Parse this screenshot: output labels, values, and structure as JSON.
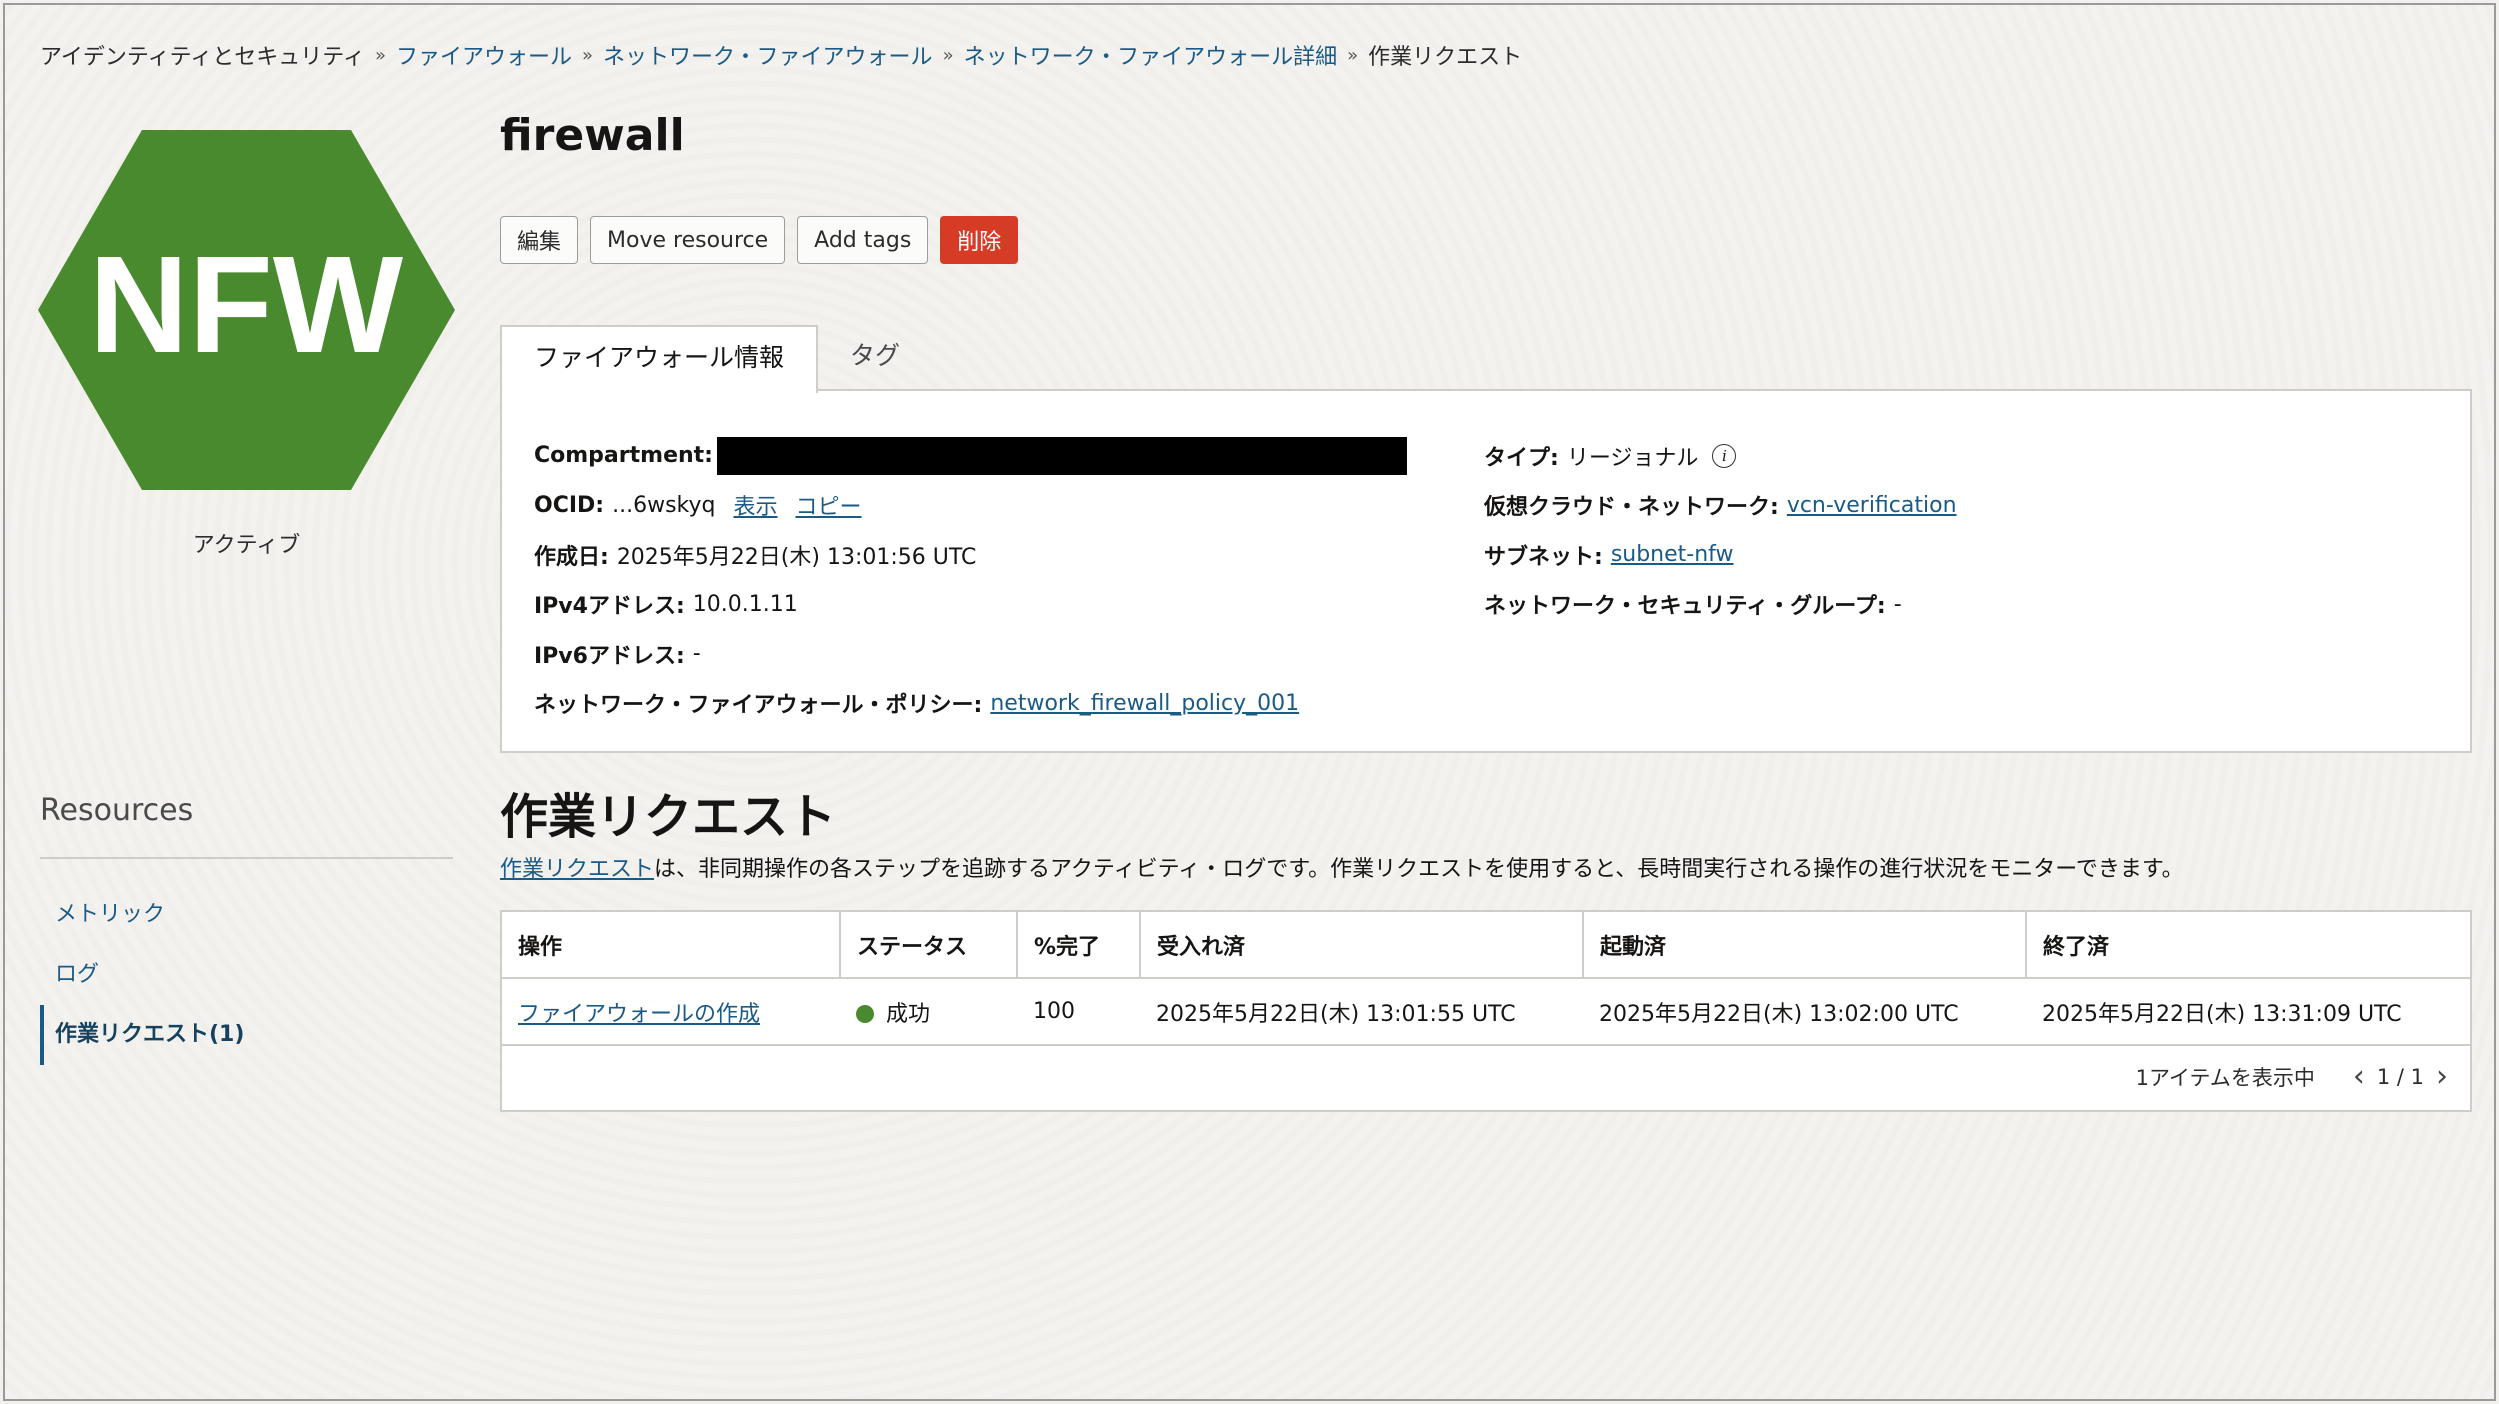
{
  "breadcrumb": [
    "アイデンティティとセキュリティ",
    "ファイアウォール",
    "ネットワーク・ファイアウォール",
    "ネットワーク・ファイアウォール詳細",
    "作業リクエスト"
  ],
  "breadcrumb_sep": "»",
  "resource_icon": {
    "text": "NFW",
    "color": "#4a8a2e"
  },
  "status": "アクティブ",
  "title": "firewall",
  "toolbar": {
    "edit": "編集",
    "move": "Move resource",
    "tags": "Add tags",
    "delete": "削除"
  },
  "tabs": [
    {
      "label": "ファイアウォール情報"
    },
    {
      "label": "タグ"
    }
  ],
  "info": {
    "compartment_label": "Compartment:",
    "ocid_label": "OCID:",
    "ocid_value": "...6wskyq",
    "ocid_show": "表示",
    "ocid_copy": "コピー",
    "created_label": "作成日:",
    "created_value": "2025年5月22日(木) 13:01:56 UTC",
    "ipv4_label": "IPv4アドレス:",
    "ipv4_value": "10.0.1.11",
    "ipv6_label": "IPv6アドレス:",
    "ipv6_value": "-",
    "policy_label": "ネットワーク・ファイアウォール・ポリシー:",
    "policy_value": "network_firewall_policy_001",
    "type_label": "タイプ:",
    "type_value": "リージョナル",
    "vcn_label": "仮想クラウド・ネットワーク:",
    "vcn_value": "vcn-verification",
    "subnet_label": "サブネット:",
    "subnet_value": "subnet-nfw",
    "nsg_label": "ネットワーク・セキュリティ・グループ:",
    "nsg_value": "-"
  },
  "work_requests": {
    "title": "作業リクエスト",
    "desc_link": "作業リクエスト",
    "desc_text": "は、非同期操作の各ステップを追跡するアクティビティ・ログです。作業リクエストを使用すると、長時間実行される操作の進行状況をモニターできます。",
    "columns": [
      "操作",
      "ステータス",
      "%完了",
      "受入れ済",
      "起動済",
      "終了済"
    ],
    "rows": [
      {
        "operation": "ファイアウォールの作成",
        "status": "成功",
        "percent": "100",
        "accepted": "2025年5月22日(木) 13:01:55 UTC",
        "started": "2025年5月22日(木) 13:02:00 UTC",
        "finished": "2025年5月22日(木) 13:31:09 UTC"
      }
    ],
    "status_color": "#4a8a2e",
    "count_text": "1アイテムを表示中",
    "page_text": "1 / 1"
  },
  "resources": {
    "title": "Resources",
    "items": [
      {
        "label": "メトリック"
      },
      {
        "label": "ログ"
      },
      {
        "label": "作業リクエスト(1)"
      }
    ]
  }
}
